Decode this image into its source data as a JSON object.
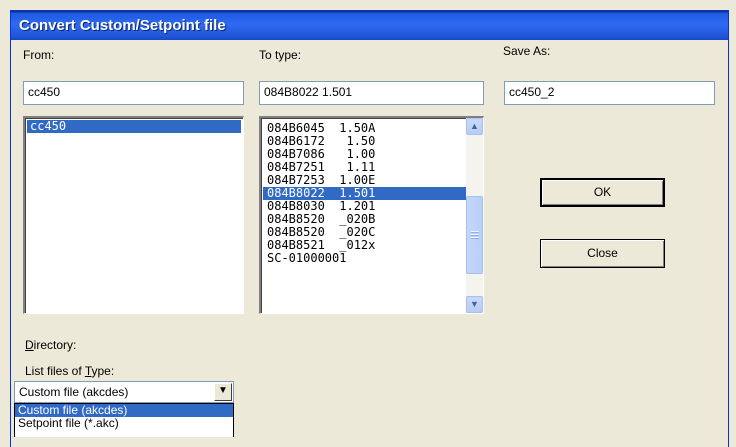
{
  "window": {
    "title": "Convert Custom/Setpoint file"
  },
  "from": {
    "label": "From:",
    "value": "cc450",
    "files": [
      {
        "name": "cc450",
        "selected": true
      }
    ]
  },
  "to_type": {
    "label": "To type:",
    "value": "084B8022 1.501",
    "types": [
      {
        "name": "084B6045  1.50A",
        "selected": false
      },
      {
        "name": "084B6172   1.50",
        "selected": false
      },
      {
        "name": "084B7086   1.00",
        "selected": false
      },
      {
        "name": "084B7251   1.11",
        "selected": false
      },
      {
        "name": "084B7253  1.00E",
        "selected": false
      },
      {
        "name": "084B8022  1.501",
        "selected": true
      },
      {
        "name": "084B8030  1.201",
        "selected": false
      },
      {
        "name": "084B8520  _020B",
        "selected": false
      },
      {
        "name": "084B8520  _020C",
        "selected": false
      },
      {
        "name": "084B8521  _012x",
        "selected": false
      },
      {
        "name": "SC-01000001",
        "selected": false
      }
    ]
  },
  "save_as": {
    "label": "Save As:",
    "value": "cc450_2"
  },
  "buttons": {
    "ok": "OK",
    "close": "Close"
  },
  "directory": {
    "label_first": "D",
    "label_rest": "irectory:"
  },
  "list_type": {
    "label_pre": "List files of ",
    "label_u": "T",
    "label_post": "ype:",
    "selected": "Custom file (akcdes)",
    "options": [
      {
        "label": "Custom file (akcdes)",
        "selected": true
      },
      {
        "label": "Setpoint file (*.akc)",
        "selected": false
      }
    ]
  },
  "icons": {
    "scroll_up": "scroll-up-arrow",
    "scroll_down": "scroll-down-arrow",
    "combo": "chevron-down-icon"
  }
}
